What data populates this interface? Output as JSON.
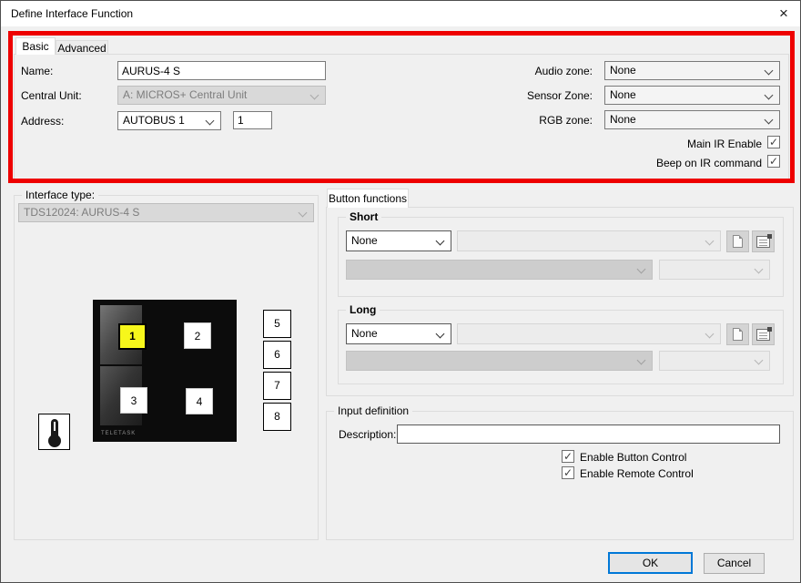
{
  "window": {
    "title": "Define Interface Function"
  },
  "tabs": {
    "basic": "Basic",
    "advanced": "Advanced"
  },
  "form": {
    "name_label": "Name:",
    "name_value": "AURUS-4 S",
    "central_unit_label": "Central Unit:",
    "central_unit_value": "A: MICROS+ Central Unit",
    "address_label": "Address:",
    "address_bus": "AUTOBUS 1",
    "address_number": "1",
    "audio_zone_label": "Audio zone:",
    "audio_zone_value": "None",
    "sensor_zone_label": "Sensor Zone:",
    "sensor_zone_value": "None",
    "rgb_zone_label": "RGB zone:",
    "rgb_zone_value": "None",
    "main_ir_label": "Main IR Enable",
    "beep_ir_label": "Beep on IR command"
  },
  "interface_type": {
    "caption": "Interface type:",
    "value": "TDS12024: AURUS-4 S"
  },
  "device": {
    "brand": "TELETASK",
    "buttons": [
      "1",
      "2",
      "3",
      "4"
    ],
    "side_buttons": [
      "5",
      "6",
      "7",
      "8"
    ],
    "selected_button": "1"
  },
  "button_functions": {
    "tab_label": "Button functions",
    "short_caption": "Short",
    "short_function": "None",
    "long_caption": "Long",
    "long_function": "None"
  },
  "input_definition": {
    "caption": "Input definition",
    "description_label": "Description:",
    "description_value": "",
    "enable_button_label": "Enable Button Control",
    "enable_remote_label": "Enable Remote Control"
  },
  "footer": {
    "ok_label": "OK",
    "cancel_label": "Cancel"
  },
  "colors": {
    "highlight_red": "#ee0000",
    "focus_blue": "#0078d7",
    "selected_button_yellow": "#f7f71b"
  }
}
